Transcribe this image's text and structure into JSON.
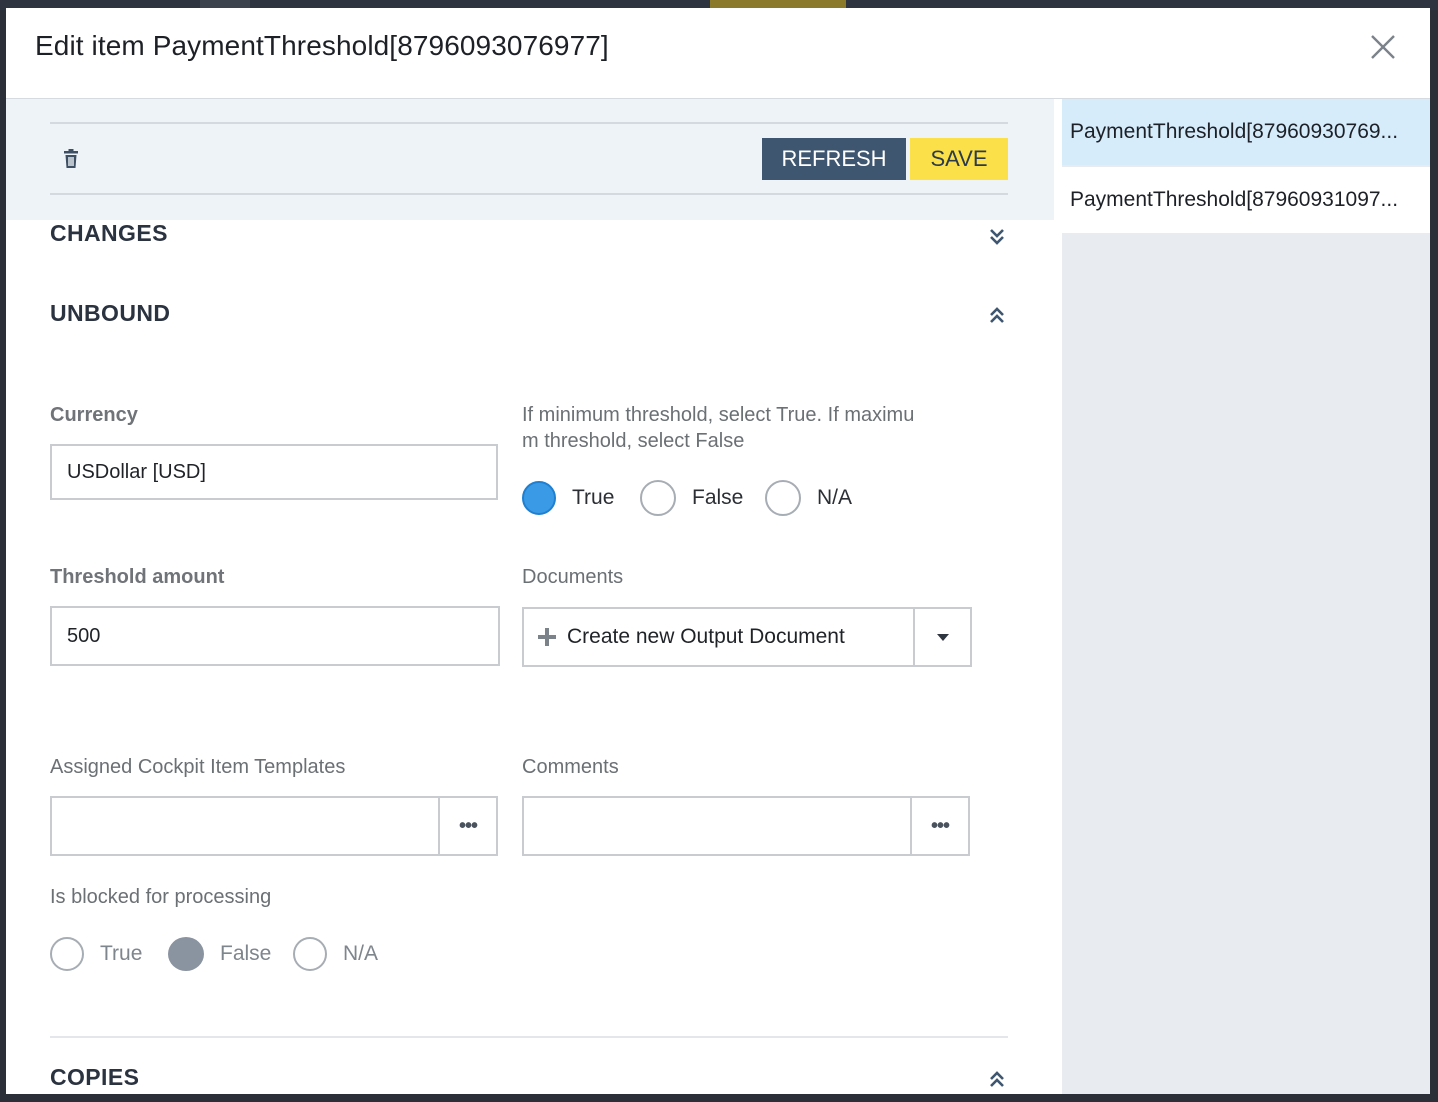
{
  "modal": {
    "title": "Edit item PaymentThreshold[8796093076977]"
  },
  "toolbar": {
    "refresh_label": "REFRESH",
    "save_label": "SAVE"
  },
  "sections": {
    "changes": "CHANGES",
    "unbound": "UNBOUND",
    "copies": "COPIES"
  },
  "fields": {
    "currency": {
      "label": "Currency",
      "value": "USDollar [USD]"
    },
    "min_threshold": {
      "label_line1": "If minimum threshold, select True. If maximu",
      "label_line2": "m threshold, select False",
      "options": [
        "True",
        "False",
        "N/A"
      ],
      "selected": "True"
    },
    "threshold_amount": {
      "label": "Threshold amount",
      "value": "500"
    },
    "documents": {
      "label": "Documents",
      "value": "Create new Output Document"
    },
    "cockpit_templates": {
      "label": "Assigned Cockpit Item Templates",
      "value": "",
      "more": "•••"
    },
    "comments": {
      "label": "Comments",
      "value": "",
      "more": "•••"
    },
    "blocked": {
      "label": "Is blocked for processing",
      "options": [
        "True",
        "False",
        "N/A"
      ],
      "selected": "False"
    }
  },
  "side_list": {
    "items": [
      {
        "label": "PaymentThreshold[87960930769...",
        "selected": true
      },
      {
        "label": "PaymentThreshold[87960931097...",
        "selected": false
      }
    ]
  },
  "colors": {
    "refresh_bg": "#3e5670",
    "save_bg": "#fbe04a",
    "radio_selected": "#3a9ae6",
    "radio_readonly_selected": "#8a93a0",
    "selected_list_item": "#d6ecfb"
  }
}
